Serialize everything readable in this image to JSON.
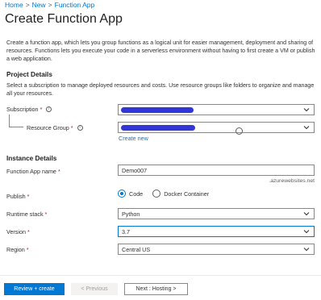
{
  "breadcrumb": [
    "Home",
    "New",
    "Function App"
  ],
  "page_title": "Create Function App",
  "intro": "Create a function app, which lets you group functions as a logical unit for easier management, deployment and sharing of resources. Functions lets you execute your code in a serverless environment without having to first create a VM or publish a web application.",
  "project_details": {
    "title": "Project Details",
    "description": "Select a subscription to manage deployed resources and costs. Use resource groups like folders to organize and manage all your resources.",
    "subscription_label": "Subscription",
    "resource_group_label": "Resource Group",
    "create_new_link": "Create new"
  },
  "instance_details": {
    "title": "Instance Details",
    "function_app_name_label": "Function App name",
    "function_app_name_value": "Demo007",
    "domain_suffix": ".azurewebsites.net",
    "publish_label": "Publish",
    "publish_options": [
      "Code",
      "Docker Container"
    ],
    "runtime_stack_label": "Runtime stack",
    "runtime_stack_value": "Python",
    "version_label": "Version",
    "version_value": "3.7",
    "region_label": "Region",
    "region_value": "Central US"
  },
  "footer": {
    "review_create": "Review + create",
    "previous": "< Previous",
    "next": "Next : Hosting >"
  },
  "colors": {
    "accent": "#0078d4",
    "redaction": "#3236d6",
    "required": "#a4262c"
  },
  "icons": {
    "info": "info-icon",
    "chevron": "chevron-down-icon"
  }
}
